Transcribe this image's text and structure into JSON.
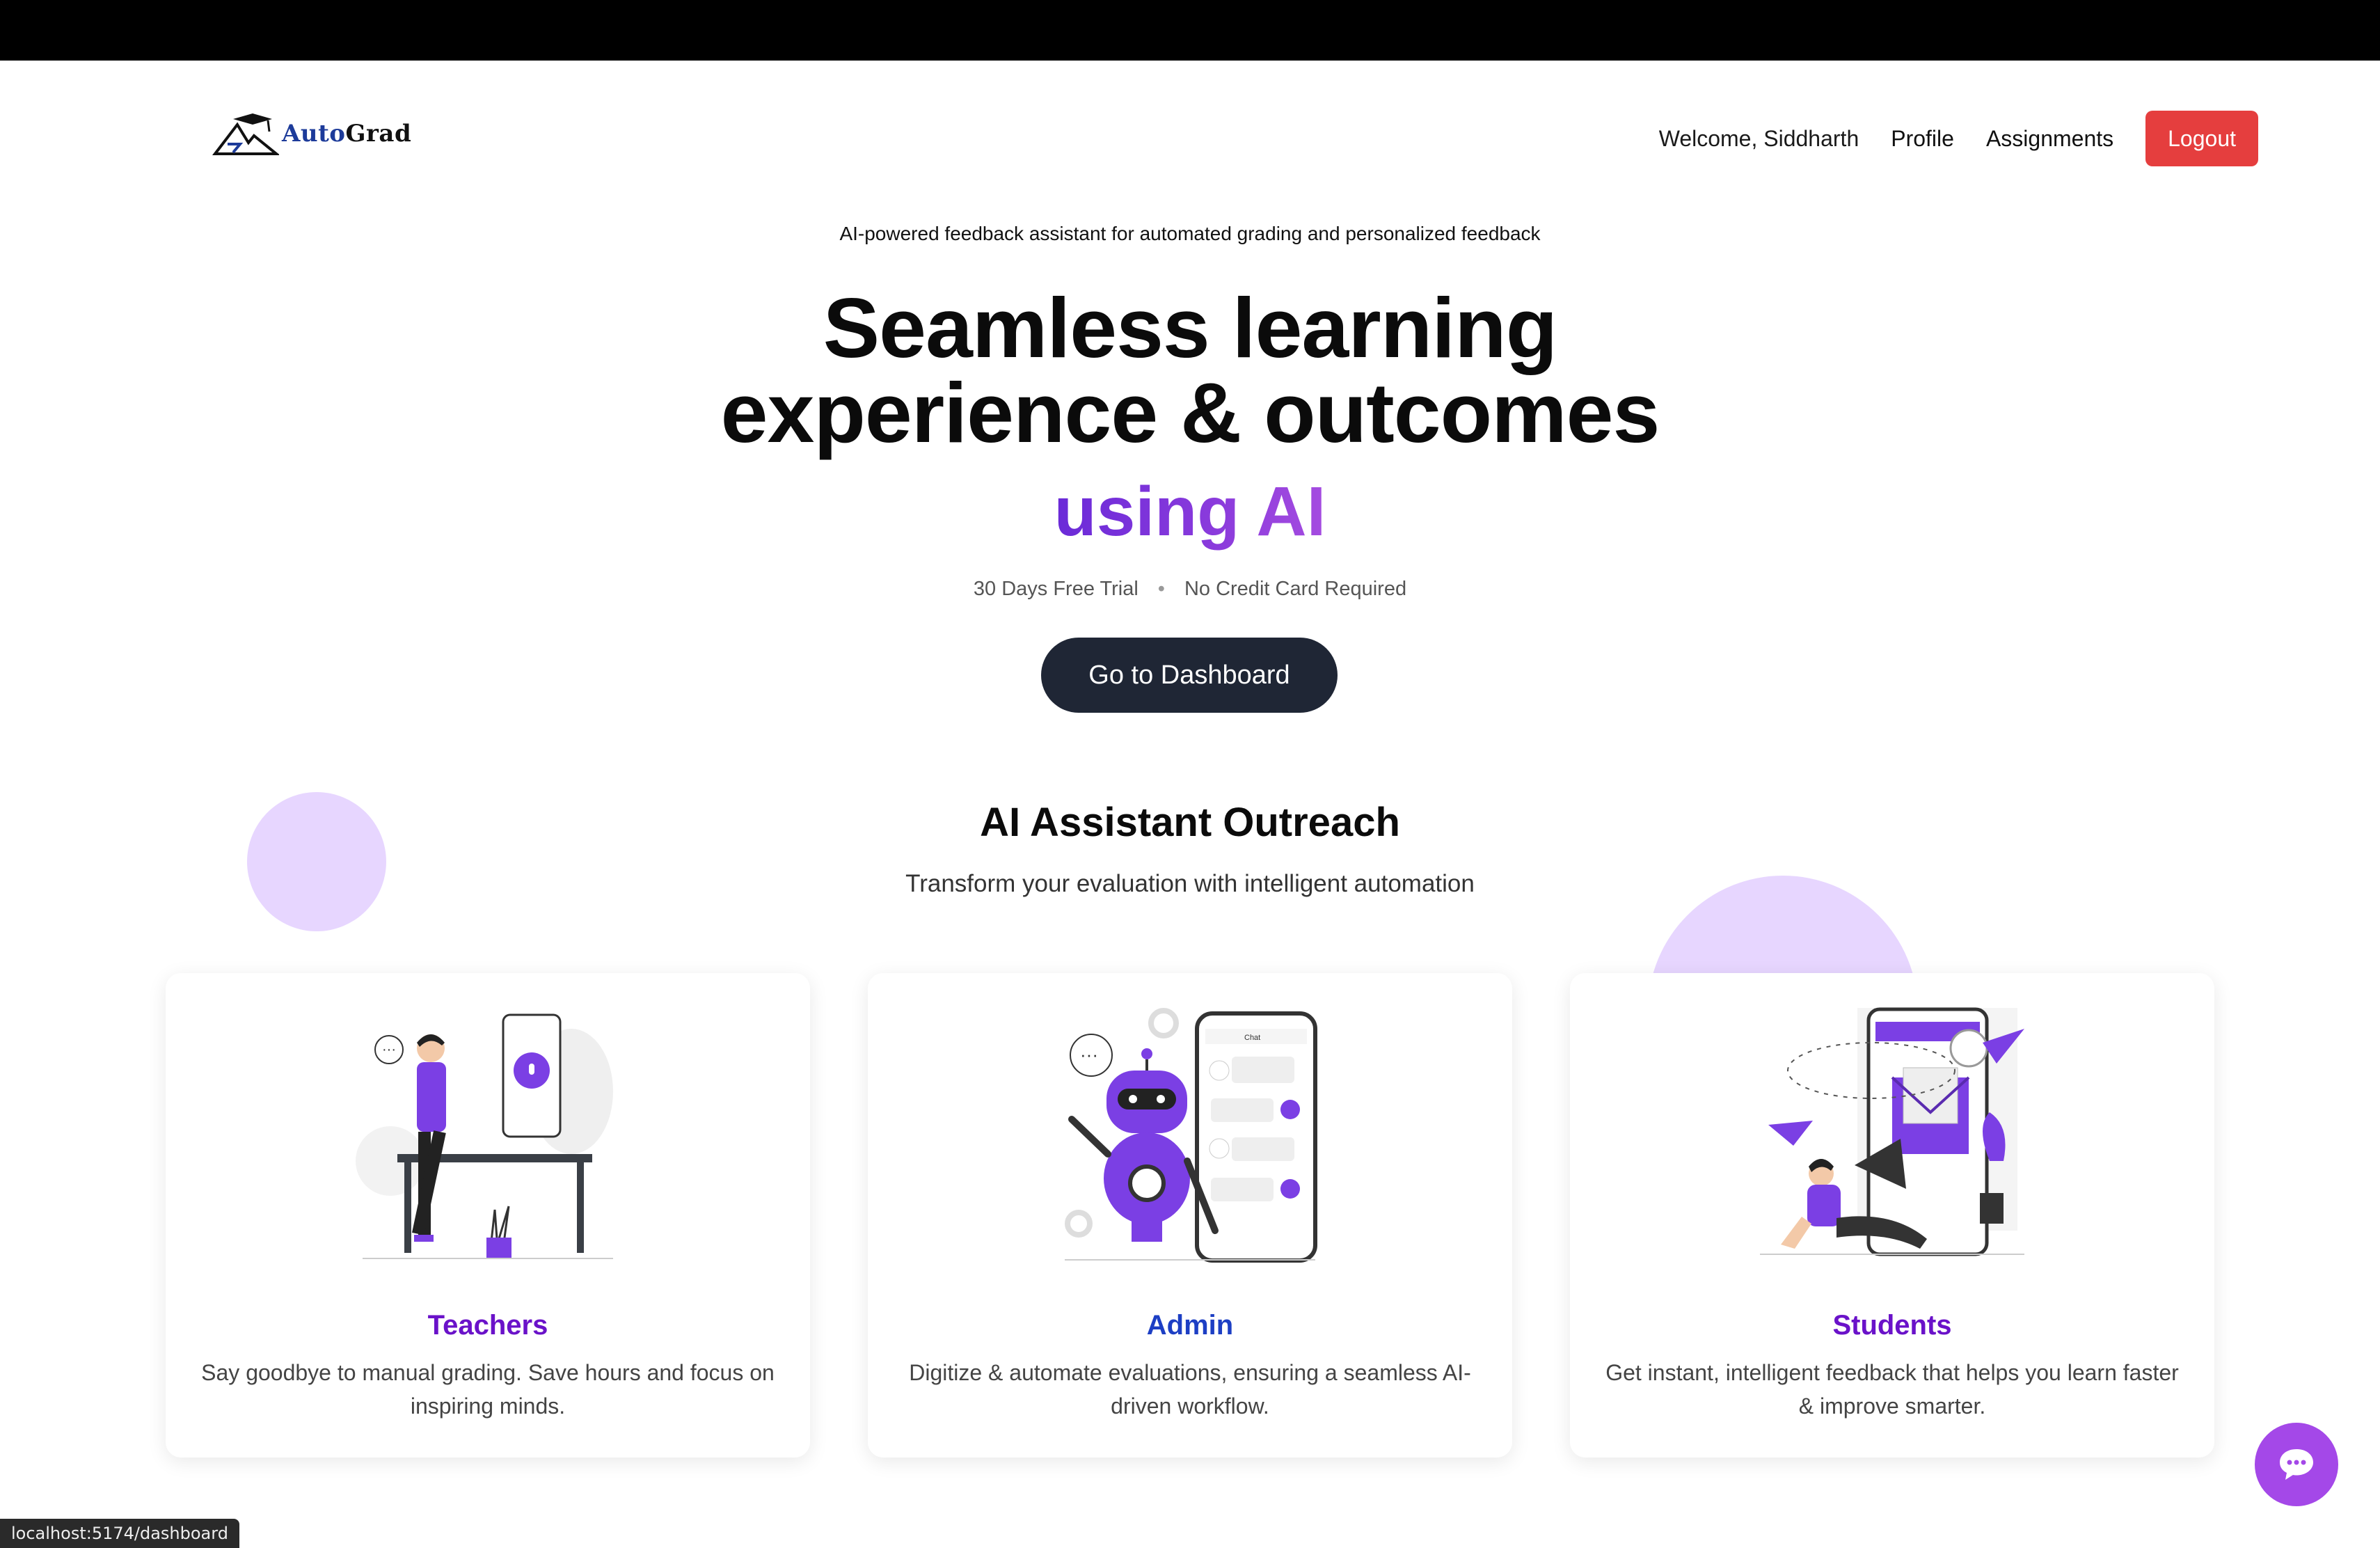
{
  "brand": {
    "auto": "Auto",
    "grad": "Grad"
  },
  "nav": {
    "welcome": "Welcome, Siddharth",
    "profile": "Profile",
    "assignments": "Assignments",
    "logout": "Logout"
  },
  "hero": {
    "tagline": "AI-powered feedback assistant for automated grading and personalized feedback",
    "headline_line1": "Seamless learning",
    "headline_line2": "experience & outcomes",
    "headline_accent": "using AI",
    "perk1": "30 Days Free Trial",
    "perk2": "No Credit Card Required",
    "cta": "Go to Dashboard"
  },
  "section": {
    "title": "AI Assistant Outreach",
    "subtitle": "Transform your evaluation with intelligent automation"
  },
  "cards": [
    {
      "title": "Teachers",
      "desc": "Say goodbye to manual grading. Save hours and focus on inspiring minds.",
      "color": "#6a12c9"
    },
    {
      "title": "Admin",
      "desc": "Digitize & automate evaluations, ensuring a seamless AI-driven workflow.",
      "color": "#1d3fc4"
    },
    {
      "title": "Students",
      "desc": "Get instant, intelligent feedback that helps you learn faster & improve smarter.",
      "color": "#6a12c9"
    }
  ],
  "status_url": "localhost:5174/dashboard",
  "colors": {
    "accent": "#7b3fe4",
    "logout": "#e53e3e",
    "cta": "#1f2635",
    "circle": "#e7d6ff"
  },
  "icons": {
    "chat": "chat-bubble-icon",
    "logo": "graduation-cap-icon"
  }
}
